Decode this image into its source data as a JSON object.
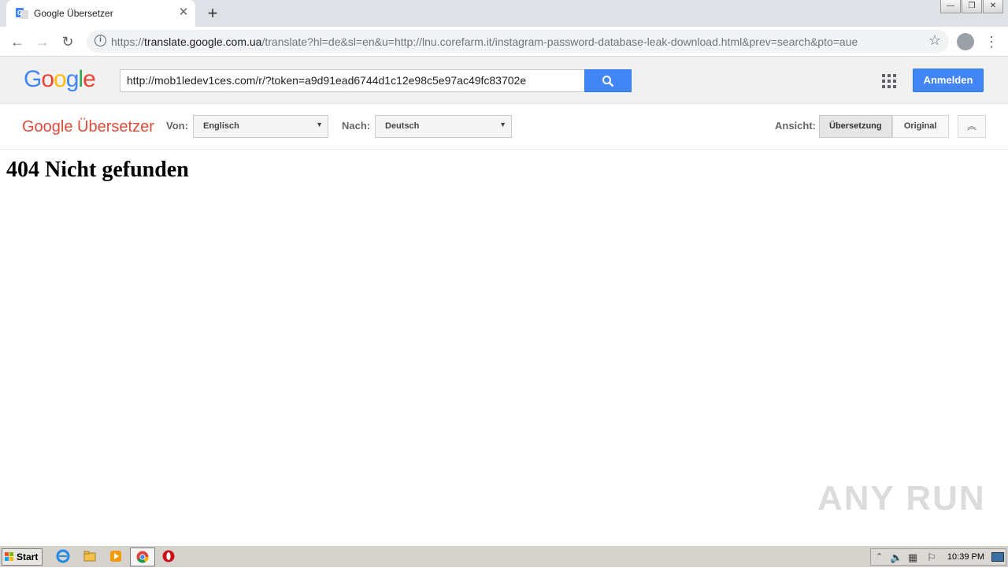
{
  "browser": {
    "tab_title": "Google Übersetzer",
    "tab_close": "✕",
    "new_tab": "+",
    "url_prefix": "https://",
    "url_host": "translate.google.com.ua",
    "url_rest": "/translate?hl=de&sl=en&u=http://lnu.corefarm.it/instagram-password-database-leak-download.html&prev=search&pto=aue",
    "back_icon": "←",
    "forward_icon": "→",
    "reload_icon": "↻",
    "info_icon": "i",
    "star_icon": "☆",
    "menu_icon": "⋮",
    "window_controls": [
      "—",
      "❐",
      "✕"
    ]
  },
  "google_header": {
    "logo_letters": [
      {
        "ch": "G",
        "color": "#4285F4"
      },
      {
        "ch": "o",
        "color": "#EA4335"
      },
      {
        "ch": "o",
        "color": "#FBBC05"
      },
      {
        "ch": "g",
        "color": "#4285F4"
      },
      {
        "ch": "l",
        "color": "#34A853"
      },
      {
        "ch": "e",
        "color": "#EA4335"
      }
    ],
    "search_value": "http://mob1ledev1ces.com/r/?token=a9d91ead6744d1c12e98c5e97ac49fc83702e",
    "search_icon": "🔍",
    "signin_label": "Anmelden"
  },
  "translate_bar": {
    "brand": "Google Übersetzer",
    "from_label": "Von:",
    "from_value": "Englisch",
    "to_label": "Nach:",
    "to_value": "Deutsch",
    "view_label": "Ansicht:",
    "view_translation": "Übersetzung",
    "view_original": "Original",
    "dropdown_arrow": "▼",
    "collapse_icon": "︽"
  },
  "content": {
    "heading": "404 Nicht gefunden"
  },
  "watermark": "ANY RUN",
  "taskbar": {
    "start_label": "Start",
    "clock": "10:39 PM"
  },
  "colors": {
    "google_blue": "#4285f4",
    "brand_red": "#dd4b39"
  }
}
